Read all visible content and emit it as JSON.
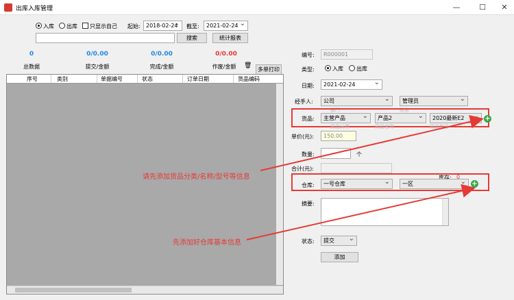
{
  "window": {
    "title": "出库入库管理",
    "min": "—",
    "max": "☐",
    "close": "✕"
  },
  "filter": {
    "radio_in": "入库",
    "radio_out": "出库",
    "only_self": "只显示自己",
    "start_label": "起始:",
    "start_value": "2018-02-24",
    "end_label": "截至:",
    "end_value": "2021-02-24",
    "search_value": "",
    "search_button": "搜索",
    "report_button": "统计报表"
  },
  "stats": [
    {
      "value": "0",
      "label": "总数据",
      "color": "#1e88e5"
    },
    {
      "value": "0/0.00",
      "label": "提交/金额",
      "color": "#1e88e5"
    },
    {
      "value": "0/0.00",
      "label": "完成/金额",
      "color": "#1e88e5"
    },
    {
      "value": "0/0.00",
      "label": "作废/金额",
      "color": "#e53935"
    }
  ],
  "multi_print": "多单打印",
  "table": {
    "columns": [
      "序号",
      "类别",
      "单据编号",
      "状态",
      "订单日期",
      "货品编码"
    ]
  },
  "form": {
    "code_label": "编号:",
    "code_value": "R000001",
    "type_label": "类型:",
    "type_in": "入库",
    "type_out": "出库",
    "date_label": "日期:",
    "date_value": "2021-02-24",
    "handler_label": "经手人:",
    "handler_dept": "公司",
    "handler_name": "管理员",
    "handler_dept_sub": "部门",
    "handler_name_sub": "姓名",
    "goods_label": "货品:",
    "goods_cat": "主营产品",
    "goods_name": "产品2",
    "goods_model": "2020最新E2",
    "goods_cat_sub": "货品分类",
    "goods_name_sub": "货品名称",
    "goods_model_sub": "货品型号",
    "price_label": "单价(元):",
    "price_value": "150.00",
    "qty_label": "数量:",
    "qty_value": "",
    "qty_unit": "个",
    "total_label": "合计(元):",
    "total_value": "",
    "stock_label": "库存:",
    "stock_value": "0",
    "warehouse_label": "仓库:",
    "warehouse_value": "一号仓库",
    "zone_value": "一区",
    "memo_label": "摘要:",
    "memo_value": "",
    "status_label": "状态:",
    "status_value": "提交",
    "add_button": "添加"
  },
  "annotations": {
    "goods_tip": "请先添加货品分类/名称/型号等信息",
    "warehouse_tip": "先添加好仓库基本信息"
  },
  "colors": {
    "annotation": "#e53935",
    "stat_blue": "#1e88e5",
    "stat_red": "#e53935"
  }
}
